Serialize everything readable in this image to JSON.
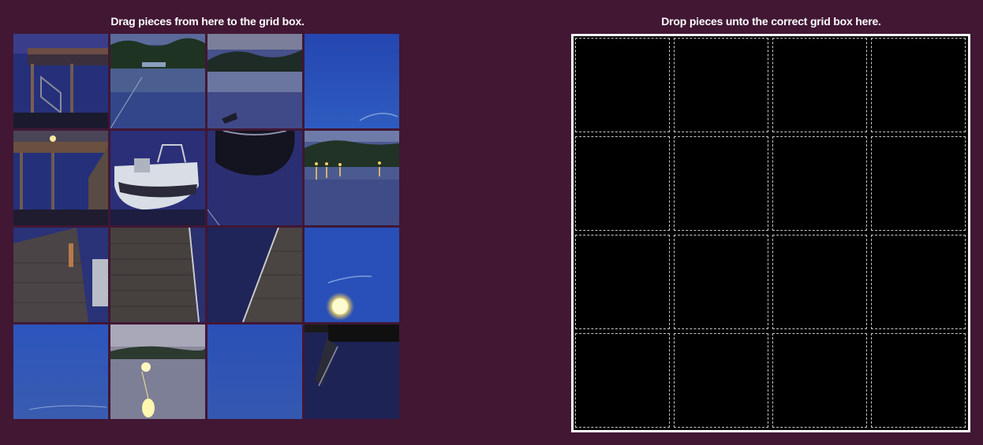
{
  "source_panel": {
    "title": "Drag pieces from here to the grid box."
  },
  "target_panel": {
    "title": "Drop pieces unto the correct grid box here."
  },
  "puzzle": {
    "rows": 4,
    "columns": 4,
    "pieces_remaining": 16,
    "pieces_placed": 0
  },
  "pieces": [
    {
      "id": "piece-1",
      "icon": "dock-ladder-icon"
    },
    {
      "id": "piece-2",
      "icon": "lake-treeline-icon"
    },
    {
      "id": "piece-3",
      "icon": "lake-shore-icon"
    },
    {
      "id": "piece-4",
      "icon": "blue-sky-icon"
    },
    {
      "id": "piece-5",
      "icon": "dock-lamp-icon"
    },
    {
      "id": "piece-6",
      "icon": "boat-icon"
    },
    {
      "id": "piece-7",
      "icon": "boat-reflection-icon"
    },
    {
      "id": "piece-8",
      "icon": "shore-lights-icon"
    },
    {
      "id": "piece-9",
      "icon": "dock-boat-edge-icon"
    },
    {
      "id": "piece-10",
      "icon": "dock-planks-icon"
    },
    {
      "id": "piece-11",
      "icon": "dock-corner-icon"
    },
    {
      "id": "piece-12",
      "icon": "moon-icon"
    },
    {
      "id": "piece-13",
      "icon": "twilight-sky-icon"
    },
    {
      "id": "piece-14",
      "icon": "moon-reflection-icon"
    },
    {
      "id": "piece-15",
      "icon": "plain-sky-icon"
    },
    {
      "id": "piece-16",
      "icon": "dock-shadow-icon"
    }
  ],
  "colors": {
    "background": "#411734",
    "board_fill": "#000000",
    "board_border": "#ffffff",
    "cell_border": "#c9c9c9"
  }
}
